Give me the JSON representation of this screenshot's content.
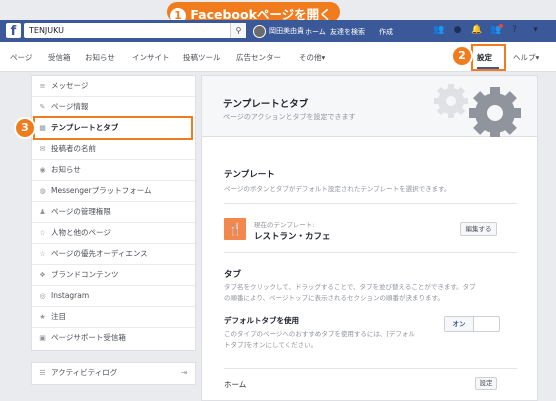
{
  "annotation": {
    "step1_number": "1",
    "step1_text": "Facebookページを開く",
    "step2_number": "2",
    "step3_number": "3"
  },
  "topbar": {
    "logo": "f",
    "search_value": "TENJUKU",
    "search_icon": "search-icon",
    "user_name": "岡田美由貴",
    "home_label": "ホーム",
    "find_friends_label": "友達を検索",
    "create_label": "作成"
  },
  "subnav": {
    "items": [
      "ページ",
      "受信箱",
      "お知らせ",
      "インサイト",
      "投稿ツール",
      "広告センター",
      "その他▾"
    ],
    "settings_label": "設定",
    "help_label": "ヘルプ▾"
  },
  "sidebar": {
    "items": [
      {
        "icon": "≡",
        "label": "メッセージ"
      },
      {
        "icon": "✎",
        "label": "ページ情報"
      },
      {
        "icon": "▦",
        "label": "テンプレートとタブ"
      },
      {
        "icon": "✉",
        "label": "投稿者の名前"
      },
      {
        "icon": "◉",
        "label": "お知らせ"
      },
      {
        "icon": "◍",
        "label": "Messengerプラットフォーム"
      },
      {
        "icon": "♟",
        "label": "ページの管理権限"
      },
      {
        "icon": "☆",
        "label": "人物と他のページ"
      },
      {
        "icon": "☆",
        "label": "ページの優先オーディエンス"
      },
      {
        "icon": "❖",
        "label": "ブランドコンテンツ"
      },
      {
        "icon": "◎",
        "label": "Instagram"
      },
      {
        "icon": "★",
        "label": "注目"
      },
      {
        "icon": "▣",
        "label": "ページサポート受信箱"
      }
    ],
    "activity_log": {
      "icon": "☰",
      "label": "アクティビティログ",
      "action_icon": "⇥"
    }
  },
  "content": {
    "header_title": "テンプレートとタブ",
    "header_desc": "ページのアクションとタブを設定できます",
    "template_section": {
      "title": "テンプレート",
      "desc": "ページのボタンとタブがデフォルト設定されたテンプレートを選択できます。",
      "current_label": "現在のテンプレート:",
      "current_name": "レストラン・カフェ",
      "edit_button": "編集する"
    },
    "tabs_section": {
      "title": "タブ",
      "desc_line1": "タブ名をクリックして、ドラッグすることで、タブを並び替えることができます。タブ",
      "desc_line2": "の順番により、ページトップに表示されるセクションの順番が決まります。",
      "default_tabs_title": "デフォルトタブを使用",
      "default_tabs_desc_line1": "このタイプのページへのおすすめタブを使用するには、[デフォル",
      "default_tabs_desc_line2": "トタブ]をオンにしてください。",
      "toggle_on": "オン",
      "home_label": "ホーム",
      "home_button": "設定"
    }
  }
}
